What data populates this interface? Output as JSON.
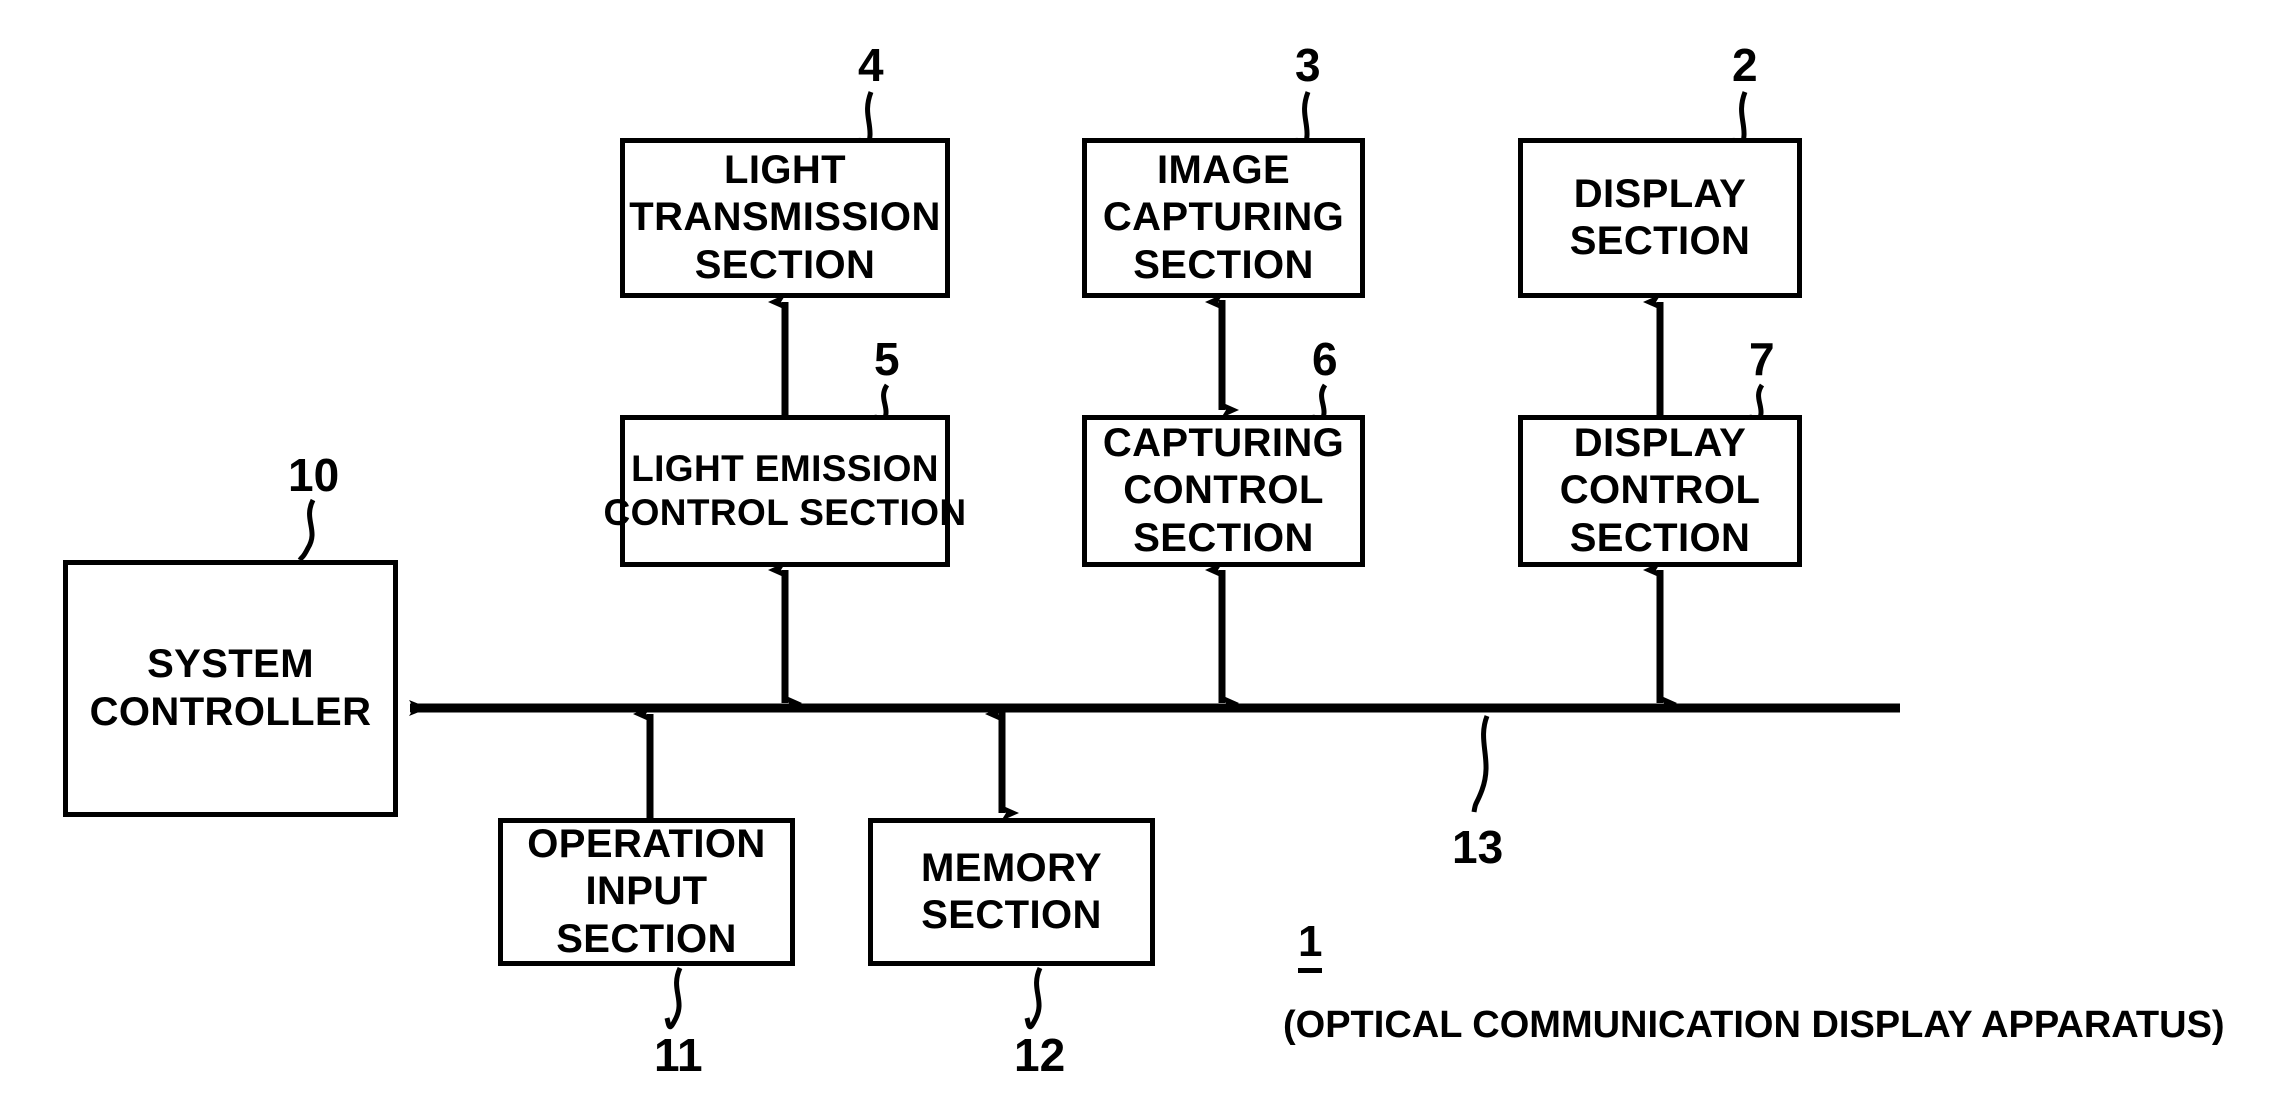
{
  "figure": {
    "type": "patent-block-diagram",
    "background_color": "#ffffff",
    "line_color": "#000000"
  },
  "blocks": {
    "light_transmission": {
      "line1": "LIGHT",
      "line2": "TRANSMISSION",
      "line3": "SECTION",
      "ref": "4"
    },
    "image_capturing": {
      "line1": "IMAGE",
      "line2": "CAPTURING",
      "line3": "SECTION",
      "ref": "3"
    },
    "display": {
      "line1": "DISPLAY",
      "line2": "SECTION",
      "ref": "2"
    },
    "light_emission_control": {
      "line1": "LIGHT EMISSION",
      "line2": "CONTROL SECTION",
      "ref": "5"
    },
    "capturing_control": {
      "line1": "CAPTURING",
      "line2": "CONTROL",
      "line3": "SECTION",
      "ref": "6"
    },
    "display_control": {
      "line1": "DISPLAY",
      "line2": "CONTROL",
      "line3": "SECTION",
      "ref": "7"
    },
    "system_controller": {
      "line1": "SYSTEM",
      "line2": "CONTROLLER",
      "ref": "10"
    },
    "operation_input": {
      "line1": "OPERATION",
      "line2": "INPUT",
      "line3": "SECTION",
      "ref": "11"
    },
    "memory": {
      "line1": "MEMORY",
      "line2": "SECTION",
      "ref": "12"
    }
  },
  "bus": {
    "ref": "13"
  },
  "caption": {
    "number": "1",
    "text": "(OPTICAL COMMUNICATION DISPLAY APPARATUS)"
  }
}
